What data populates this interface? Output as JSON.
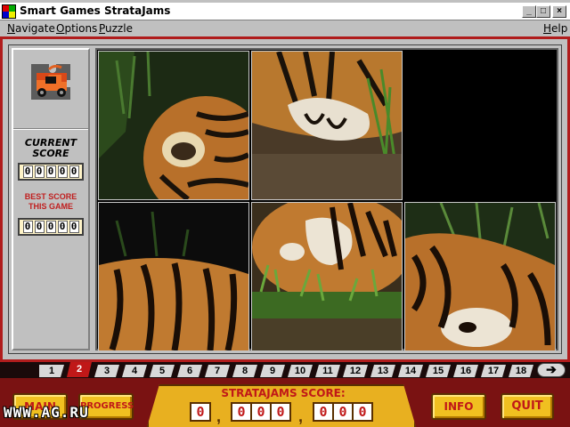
{
  "window": {
    "title": "Smart Games StrataJams",
    "controls": {
      "minimize": "_",
      "maximize": "□",
      "close": "×"
    }
  },
  "menu": {
    "items": [
      "Navigate",
      "Options",
      "Puzzle"
    ],
    "help": "Help"
  },
  "panel": {
    "current_label_1": "CURRENT",
    "current_label_2": "SCORE",
    "current_digits": [
      "0",
      "0",
      "0",
      "0",
      "0"
    ],
    "best_label_1": "BEST SCORE",
    "best_label_2": "THIS GAME",
    "best_digits": [
      "0",
      "0",
      "0",
      "0",
      "0"
    ],
    "undo_icon": "undo-arrow-icon",
    "stop_icon": "stop-icon"
  },
  "puzzle": {
    "image_subject": "tiger",
    "grid": "3x2",
    "empty_tile": "top-right"
  },
  "levels": {
    "items": [
      "1",
      "2",
      "3",
      "4",
      "5",
      "6",
      "7",
      "8",
      "9",
      "10",
      "11",
      "12",
      "13",
      "14",
      "15",
      "16",
      "17",
      "18"
    ],
    "active": "2",
    "next_icon": "next-arrow-icon"
  },
  "bottom": {
    "main_button": "MAIN",
    "progress_button": "PROGRESS",
    "score_label": "STRATAJAMS SCORE:",
    "score_group_1": [
      "0"
    ],
    "score_group_2": [
      "0",
      "0",
      "0"
    ],
    "score_group_3": [
      "0",
      "0",
      "0"
    ],
    "info_button": "INFO",
    "quit_button": "QUIT",
    "watermark": "WWW.AG.RU"
  },
  "colors": {
    "frame_red": "#b01c1c",
    "gold": "#f0c020",
    "score_red": "#c01818"
  }
}
